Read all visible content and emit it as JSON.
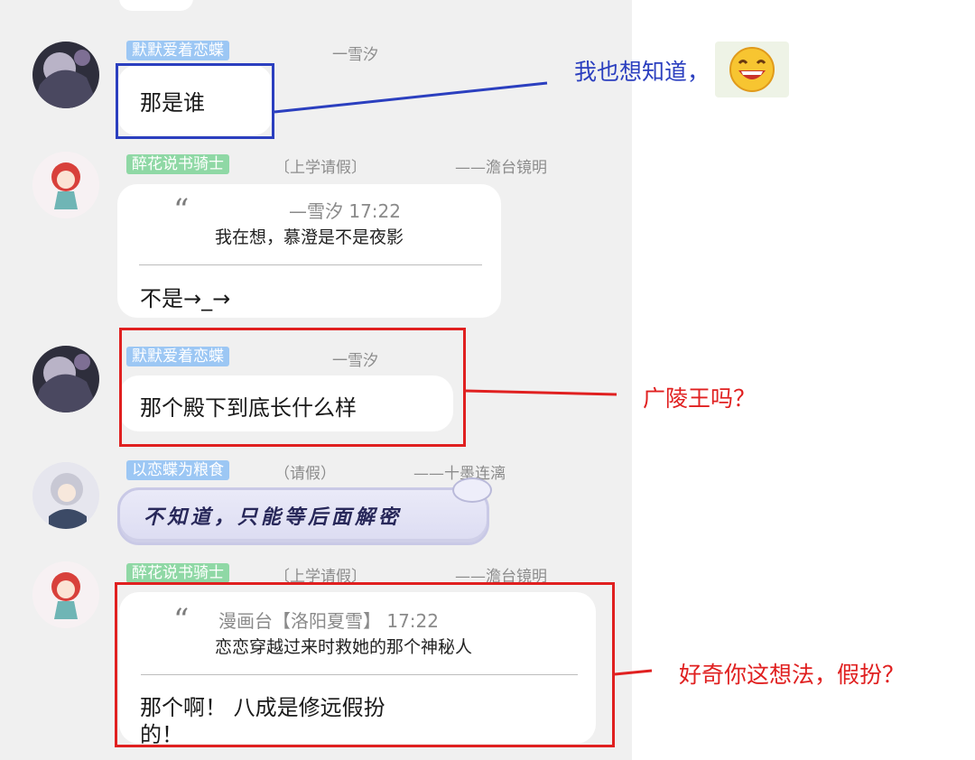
{
  "messages": [
    {
      "name": "默默爱着恋蝶",
      "role": "",
      "sig": "一雪汐",
      "text": "那是谁"
    },
    {
      "name": "醉花说书骑士",
      "role": "〔上学请假〕",
      "sig": "——澹台镜明",
      "quote": {
        "mark": "“",
        "header": "—雪汐 17:22",
        "body": "我在想，慕澄是不是夜影"
      },
      "text": "不是→_→"
    },
    {
      "name": "默默爱着恋蝶",
      "role": "",
      "sig": "一雪汐",
      "text": "那个殿下到底长什么样"
    },
    {
      "name": "以恋蝶为粮食",
      "role": "（请假）",
      "sig": "——十墨连漓",
      "text": "不知道，只能等后面解密"
    },
    {
      "name": "醉花说书骑士",
      "role": "〔上学请假〕",
      "sig": "——澹台镜明",
      "quote": {
        "mark": "“",
        "header": "漫画台【洛阳夏雪】 17:22",
        "body": "恋恋穿越过来时救她的那个神秘人"
      },
      "text_line1": "那个啊！ 八成是修远假扮",
      "text_line2": "的！"
    }
  ],
  "annotations": {
    "first": "我也想知道，",
    "second": "广陵王吗？",
    "third": "好奇你这想法，假扮？"
  },
  "colors": {
    "annotation_blue": "#2b3fbf",
    "annotation_red": "#e02020",
    "name_tag_blue": "#9cc7f4",
    "name_tag_green": "#8fd8a5"
  },
  "icons": {
    "emoji": "grinning-face-emoji",
    "avatar_1": "dark-haired-character-avatar",
    "avatar_2": "red-haired-chibi-avatar",
    "avatar_3": "silver-haired-character-avatar"
  }
}
